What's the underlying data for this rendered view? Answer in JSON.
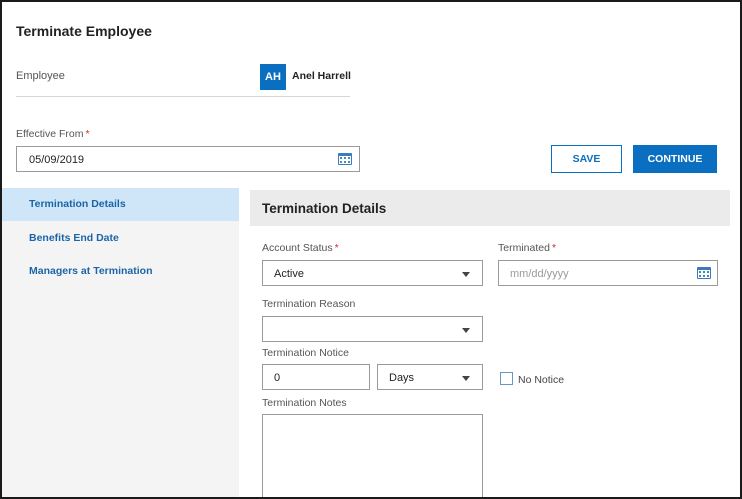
{
  "header": {
    "title": "Terminate Employee"
  },
  "employee": {
    "label": "Employee",
    "initials": "AH",
    "name": "Anel Harrell"
  },
  "effective_from": {
    "label": "Effective From",
    "required_mark": "*",
    "value": "05/09/2019"
  },
  "actions": {
    "save_label": "SAVE",
    "continue_label": "CONTINUE"
  },
  "sidebar": {
    "items": [
      {
        "label": "Termination Details",
        "active": true
      },
      {
        "label": "Benefits End Date",
        "active": false
      },
      {
        "label": "Managers at Termination",
        "active": false
      }
    ]
  },
  "panel": {
    "title": "Termination Details",
    "account_status": {
      "label": "Account Status",
      "required_mark": "*",
      "value": "Active"
    },
    "terminated": {
      "label": "Terminated",
      "required_mark": "*",
      "placeholder": "mm/dd/yyyy"
    },
    "termination_reason": {
      "label": "Termination Reason",
      "value": ""
    },
    "termination_notice": {
      "label": "Termination Notice",
      "value": "0",
      "unit": "Days",
      "no_notice_label": "No Notice",
      "no_notice_checked": false
    },
    "termination_notes": {
      "label": "Termination Notes",
      "value": ""
    }
  },
  "colors": {
    "accent": "#0b6fc1",
    "required": "#d9282f",
    "sidebar_active": "#cfe6f8",
    "sidebar_bg": "#f4f4f4"
  }
}
